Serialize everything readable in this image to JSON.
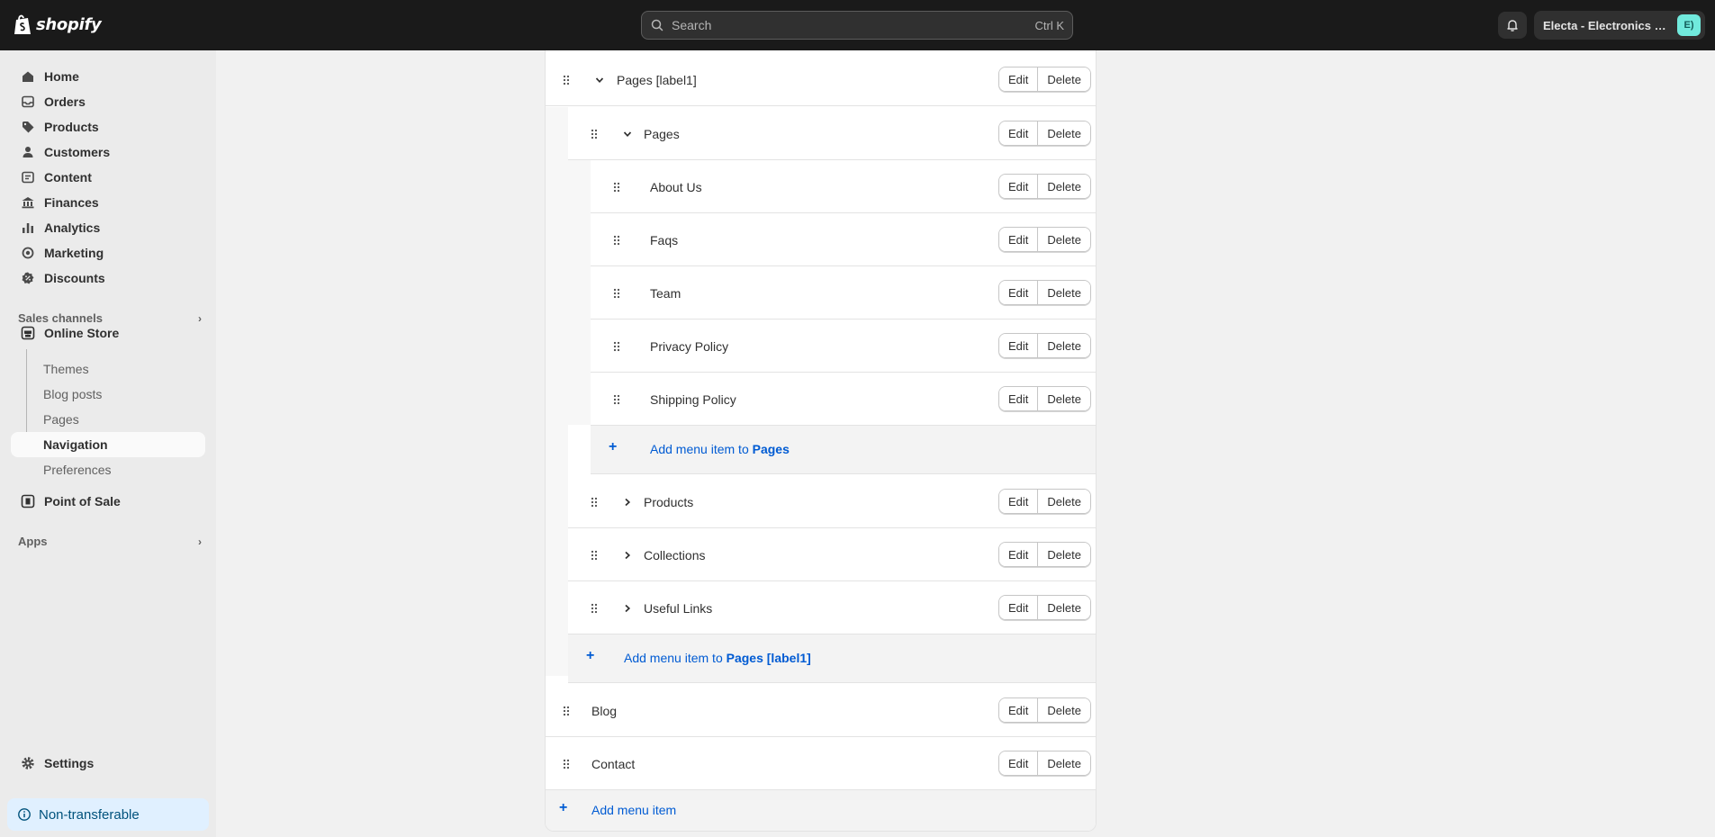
{
  "topbar": {
    "brand": "shopify",
    "search_placeholder": "Search",
    "search_shortcut": "Ctrl K",
    "store_name": "Electa - Electronics Gallery",
    "store_initials": "E)"
  },
  "sidebar": {
    "items": [
      {
        "label": "Home",
        "icon": "home-icon"
      },
      {
        "label": "Orders",
        "icon": "inbox-icon"
      },
      {
        "label": "Products",
        "icon": "tag-icon"
      },
      {
        "label": "Customers",
        "icon": "person-icon"
      },
      {
        "label": "Content",
        "icon": "content-icon"
      },
      {
        "label": "Finances",
        "icon": "bank-icon"
      },
      {
        "label": "Analytics",
        "icon": "bar-chart-icon"
      },
      {
        "label": "Marketing",
        "icon": "target-icon"
      },
      {
        "label": "Discounts",
        "icon": "discount-icon"
      }
    ],
    "sales_channels_label": "Sales channels",
    "online_store_label": "Online Store",
    "online_store_sub": [
      "Themes",
      "Blog posts",
      "Pages",
      "Navigation",
      "Preferences"
    ],
    "active_sub": "Navigation",
    "point_of_sale_label": "Point of Sale",
    "apps_label": "Apps",
    "settings_label": "Settings",
    "non_transferable_label": "Non-transferable"
  },
  "menu": {
    "edit_label": "Edit",
    "delete_label": "Delete",
    "rows": [
      {
        "label": "Pages [label1]",
        "level": 0,
        "caret": "down"
      },
      {
        "label": "Pages",
        "level": 1,
        "caret": "down"
      },
      {
        "label": "About Us",
        "level": 2
      },
      {
        "label": "Faqs",
        "level": 2
      },
      {
        "label": "Team",
        "level": 2
      },
      {
        "label": "Privacy Policy",
        "level": 2
      },
      {
        "label": "Shipping Policy",
        "level": 2
      },
      {
        "label": "Products",
        "level": 1,
        "caret": "right"
      },
      {
        "label": "Collections",
        "level": 1,
        "caret": "right"
      },
      {
        "label": "Useful Links",
        "level": 1,
        "caret": "right"
      },
      {
        "label": "Blog",
        "level": 0
      },
      {
        "label": "Contact",
        "level": 0
      }
    ],
    "add_to_pages": {
      "prefix": "Add menu item to ",
      "target": "Pages"
    },
    "add_to_pages_label1": {
      "prefix": "Add menu item to ",
      "target": "Pages [label1]"
    },
    "add_menu_item": "Add menu item"
  }
}
